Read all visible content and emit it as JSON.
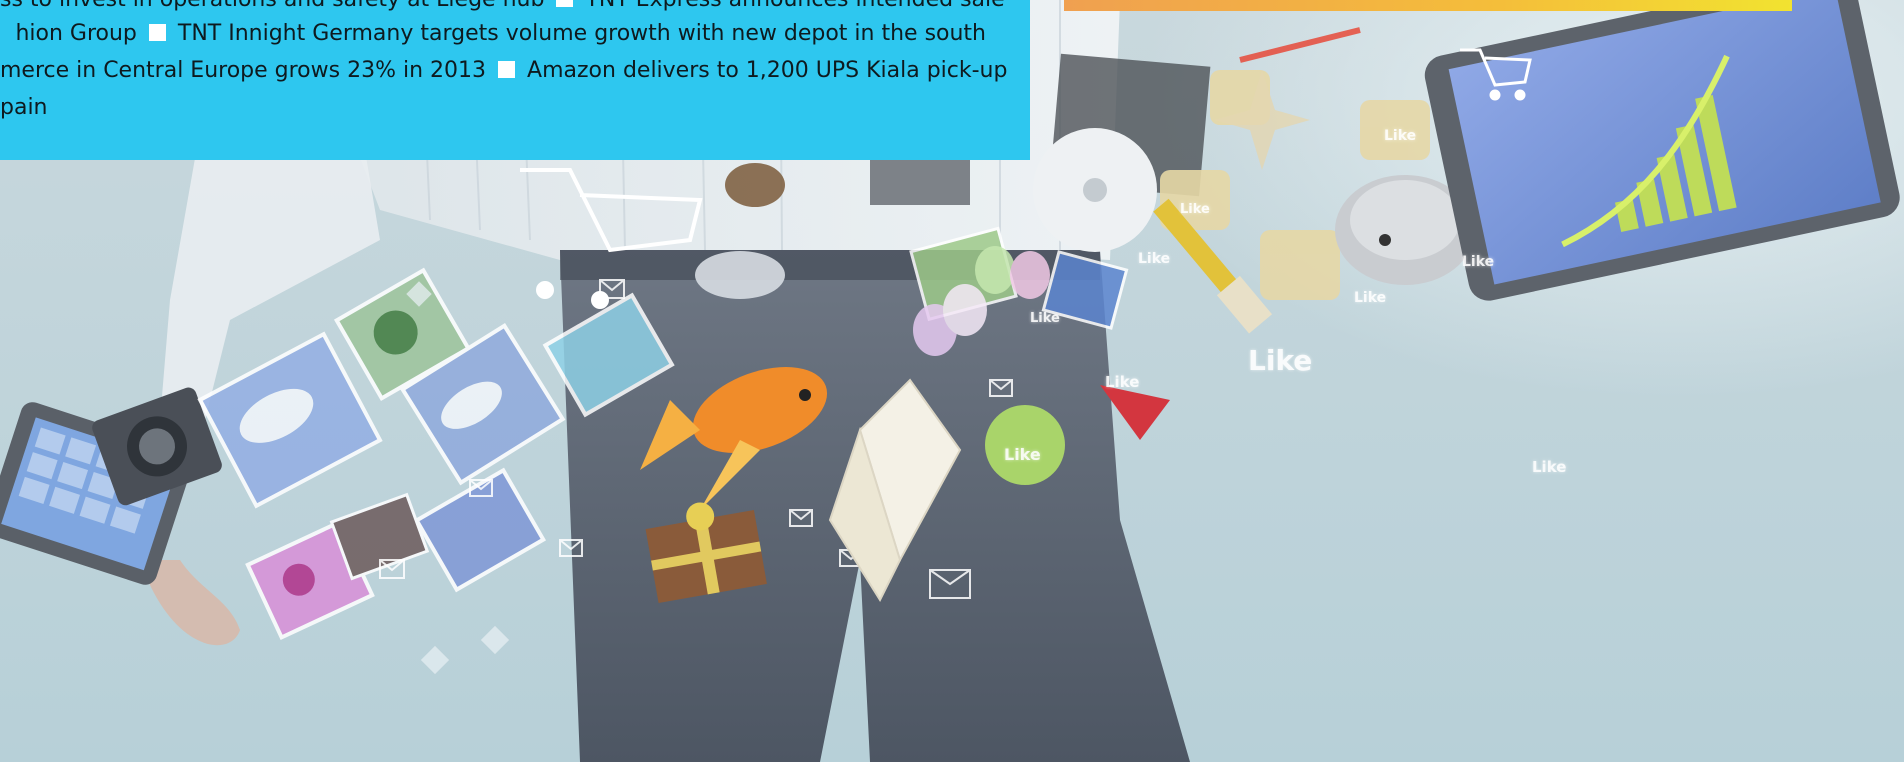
{
  "ticker": {
    "lines": [
      [
        "ss to invest in operations and safety at Liege hub",
        "TNT Express announces intended sale"
      ],
      [
        "hion Group",
        "TNT Innight Germany targets volume growth with new depot in the south"
      ],
      [
        "merce in Central Europe grows 23% in 2013",
        "Amazon delivers to 1,200 UPS Kiala pick-up"
      ],
      [
        "pain"
      ]
    ]
  },
  "likes": {
    "l1": "Like",
    "l2": "Like",
    "l3": "Like",
    "l4": "Like",
    "l5": "Like",
    "l6": "Like",
    "l7": "Like",
    "l8": "Like",
    "l9": "Like",
    "l10": "Like"
  },
  "colors": {
    "ticker_bg": "#2ec7ef",
    "banner_start": "#f0a050",
    "banner_end": "#f2e330",
    "background": "#c6d7dc"
  }
}
